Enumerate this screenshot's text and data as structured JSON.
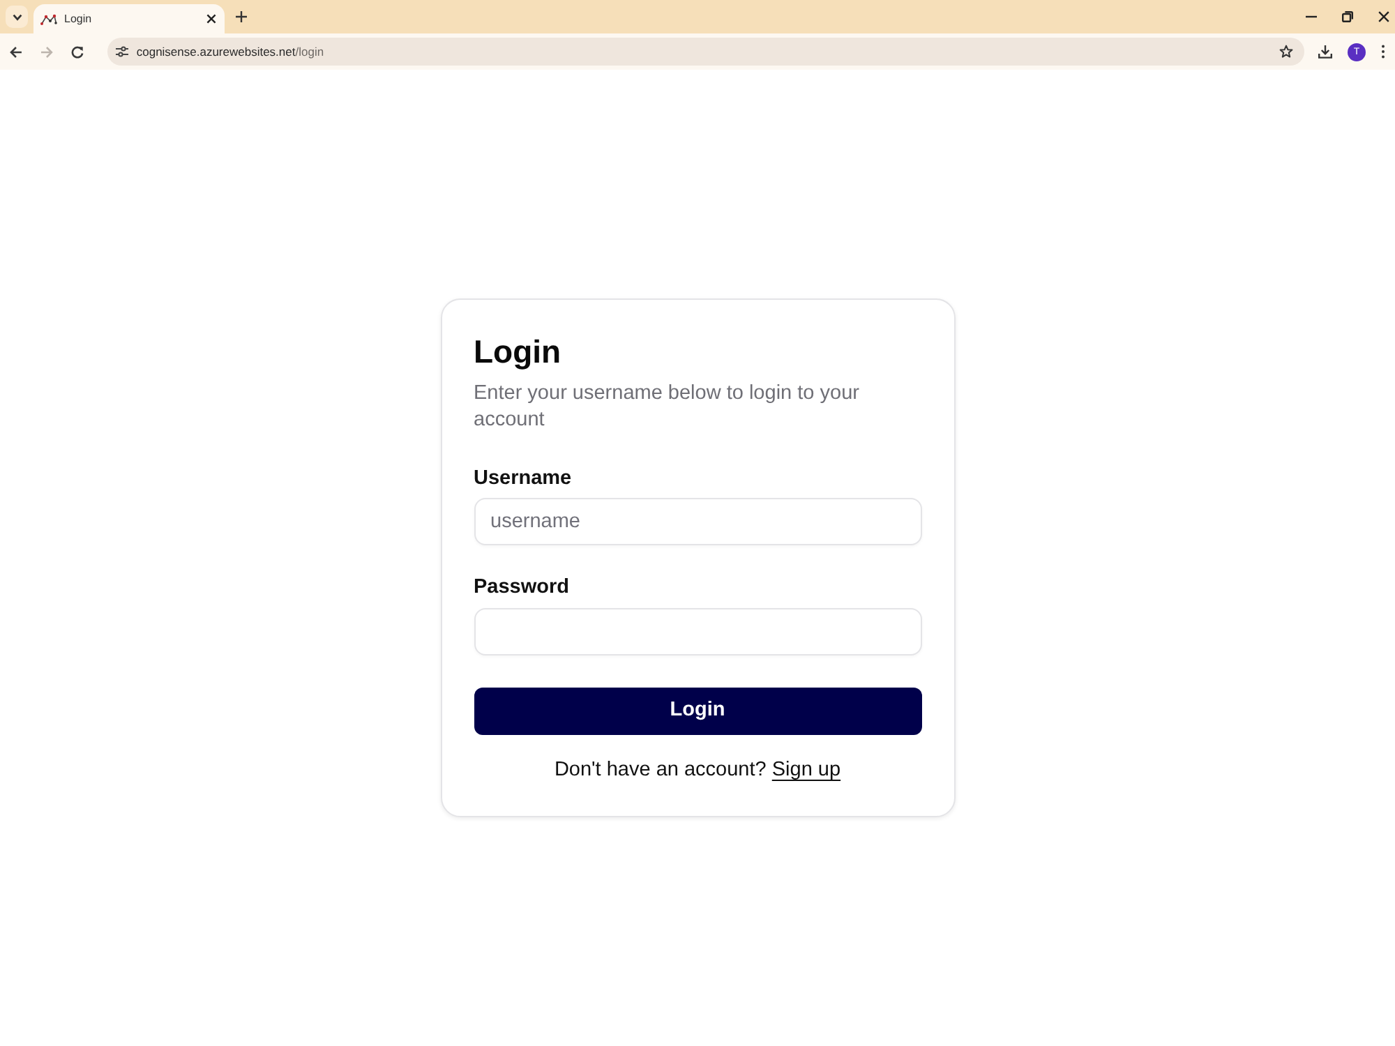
{
  "browser": {
    "tabs": [
      {
        "title": "Login",
        "selected": true
      }
    ],
    "nav_buttons": [
      {
        "kind": "back",
        "disabled": false
      },
      {
        "kind": "forward",
        "disabled": true
      },
      {
        "kind": "reload",
        "disabled": false
      }
    ],
    "address": {
      "host": "cognisense.azurewebsites.net",
      "path": "/login"
    },
    "profile_initial": "T"
  },
  "login_card": {
    "title": "Login",
    "description": "Enter your username below to login to your account",
    "fields": [
      {
        "label": "Username",
        "placeholder": "username"
      },
      {
        "label": "Password"
      }
    ],
    "submit": "Login",
    "footer": {
      "text": "Don't have an account?",
      "link": "Sign up"
    }
  }
}
